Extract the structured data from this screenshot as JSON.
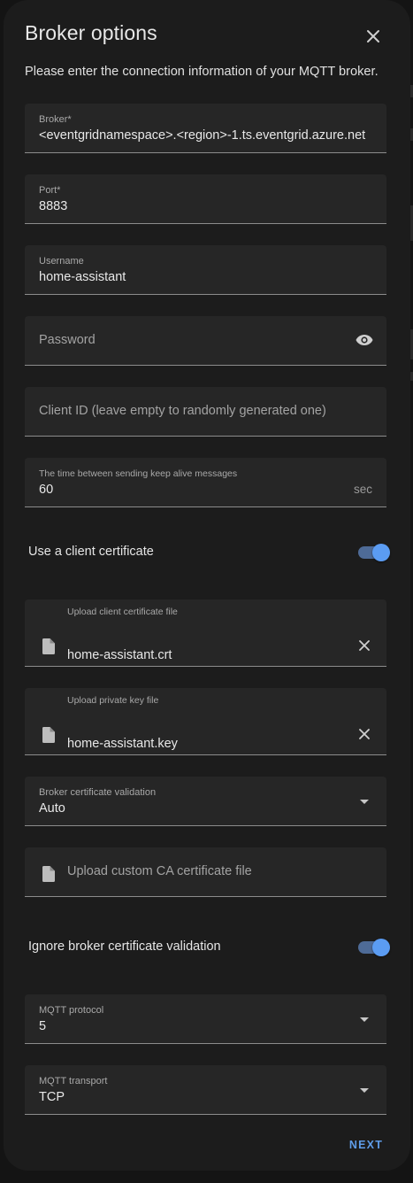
{
  "dialog": {
    "title": "Broker options",
    "description": "Please enter the connection information of your MQTT broker.",
    "close_icon": "close-icon"
  },
  "fields": {
    "broker": {
      "label": "Broker*",
      "value": "<eventgridnamespace>.<region>-1.ts.eventgrid.azure.net"
    },
    "port": {
      "label": "Port*",
      "value": "8883"
    },
    "username": {
      "label": "Username",
      "value": "home-assistant"
    },
    "password": {
      "placeholder": "Password",
      "toggle_icon": "eye-icon"
    },
    "client_id": {
      "placeholder": "Client ID (leave empty to randomly generated one)"
    },
    "keepalive": {
      "label": "The time between sending keep alive messages",
      "value": "60",
      "suffix": "sec"
    },
    "client_cert_switch": {
      "label": "Use a client certificate",
      "on": true
    },
    "client_cert_file": {
      "label": "Upload client certificate file",
      "value": "home-assistant.crt"
    },
    "private_key_file": {
      "label": "Upload private key file",
      "value": "home-assistant.key"
    },
    "cert_validation": {
      "label": "Broker certificate validation",
      "value": "Auto"
    },
    "ca_file": {
      "placeholder": "Upload custom CA certificate file"
    },
    "ignore_validation_switch": {
      "label": "Ignore broker certificate validation",
      "on": true
    },
    "protocol": {
      "label": "MQTT protocol",
      "value": "5"
    },
    "transport": {
      "label": "MQTT transport",
      "value": "TCP"
    }
  },
  "actions": {
    "next_label": "NEXT"
  },
  "colors": {
    "dialog_bg": "#1c1c1c",
    "field_bg": "#262626",
    "accent": "#5b9cf2",
    "text": "#e1e1e1"
  }
}
